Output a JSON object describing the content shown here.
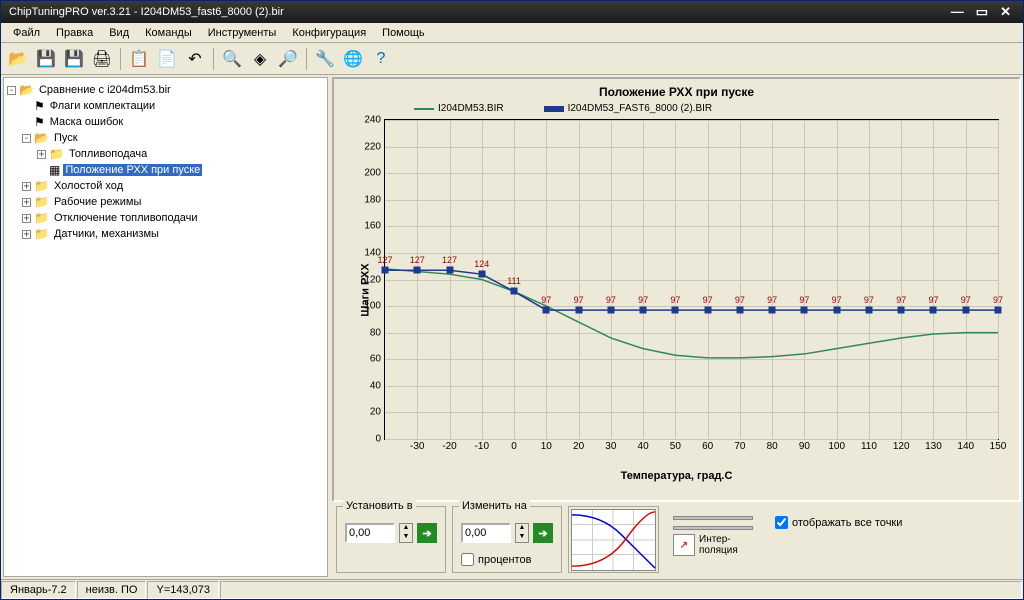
{
  "window": {
    "title": "ChipTuningPRO ver.3.21 - I204DM53_fast6_8000 (2).bir"
  },
  "menu": {
    "items": [
      "Файл",
      "Правка",
      "Вид",
      "Команды",
      "Инструменты",
      "Конфигурация",
      "Помощь"
    ]
  },
  "tree": {
    "root": "Сравнение с i204dm53.bir",
    "flags": "Флаги комплектации",
    "errmask": "Маска ошибок",
    "pusk": "Пуск",
    "fuel": "Топливоподача",
    "pxx": "Положение РХХ при пуске",
    "idle": "Холостой ход",
    "work": "Рабочие режимы",
    "cutoff": "Отключение топливоподачи",
    "sensors": "Датчики, механизмы"
  },
  "chart_data": {
    "type": "line",
    "title": "Положение РХХ при пуске",
    "xlabel": "Температура, град.C",
    "ylabel": "Шаги РХХ",
    "ylim": [
      0,
      240
    ],
    "xlim": [
      -40,
      150
    ],
    "yticks": [
      0,
      20,
      40,
      60,
      80,
      100,
      120,
      140,
      160,
      180,
      200,
      220,
      240
    ],
    "xticks": [
      -30,
      -20,
      -10,
      0,
      10,
      20,
      30,
      40,
      50,
      60,
      70,
      80,
      90,
      100,
      110,
      120,
      130,
      140,
      150
    ],
    "legend": [
      "I204DM53.BIR",
      "I204DM53_FAST6_8000 (2).BIR"
    ],
    "x": [
      -40,
      -30,
      -20,
      -10,
      0,
      10,
      20,
      30,
      40,
      50,
      60,
      70,
      80,
      90,
      100,
      110,
      120,
      130,
      140,
      150
    ],
    "series": [
      {
        "name": "I204DM53.BIR",
        "color": "#2e8b57",
        "values": [
          128,
          126,
          124,
          120,
          111,
          100,
          88,
          76,
          68,
          63,
          61,
          61,
          62,
          64,
          68,
          72,
          76,
          79,
          80,
          80
        ]
      },
      {
        "name": "I204DM53_FAST6_8000 (2).BIR",
        "color": "#1e3a8a",
        "values": [
          127,
          127,
          127,
          124,
          111,
          97,
          97,
          97,
          97,
          97,
          97,
          97,
          97,
          97,
          97,
          97,
          97,
          97,
          97,
          97
        ],
        "markers": true,
        "labels": [
          127,
          127,
          127,
          124,
          111,
          97,
          97,
          97,
          97,
          97,
          97,
          97,
          97,
          97,
          97,
          97,
          97,
          97,
          97,
          97
        ]
      }
    ]
  },
  "bottom": {
    "set_label": "Установить в",
    "change_label": "Изменить на",
    "set_val": "0,00",
    "change_val": "0,00",
    "percent": "процентов",
    "interp": "Интер-\nполяция",
    "showall": "отображать все точки"
  },
  "status": {
    "ecu": "Январь-7.2",
    "fw": "неизв. ПО",
    "coord": "Y=143,073"
  }
}
